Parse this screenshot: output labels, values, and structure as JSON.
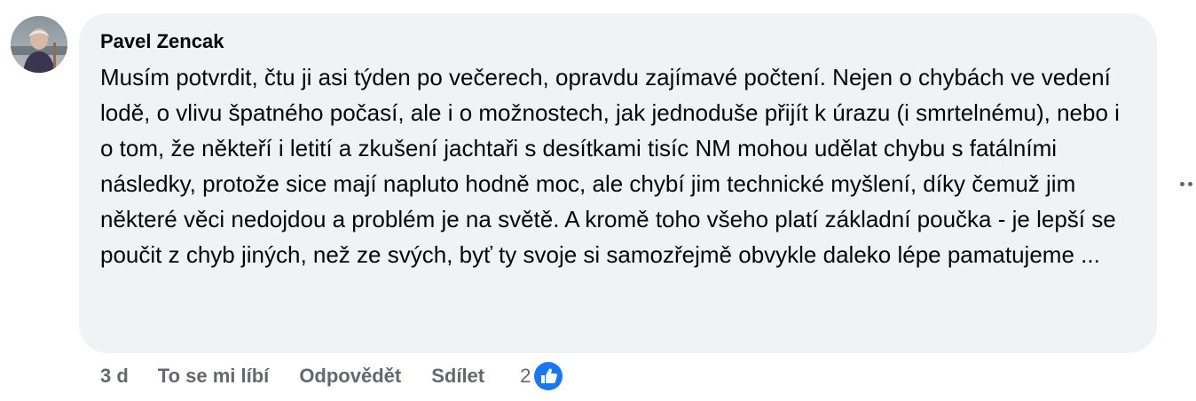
{
  "comment": {
    "author": "Pavel Zencak",
    "text": "Musím potvrdit, čtu ji asi týden po večerech, opravdu zajímavé počtení. Nejen o chybách ve vedení lodě, o vlivu špatného počasí, ale i o možnostech, jak jednoduše přijít k úrazu (i smrtelnému), nebo i o tom, že někteří i letití a zkušení jachtaři s desítkami tisíc NM mohou udělat chybu s fatálními následky, protože sice mají napluto hodně moc, ale chybí jim technické myšlení, díky čemuž jim některé věci nedojdou a problém je na světě. A kromě toho všeho platí základní poučka - je lepší se poučit z chyb jiných, než ze svých, byť ty svoje si samozřejmě obvykle daleko lépe pamatujeme ..."
  },
  "actions": {
    "time": "3 d",
    "like": "To se mi líbí",
    "reply": "Odpovědět",
    "share": "Sdílet"
  },
  "reactions": {
    "count": "2",
    "icon": "thumbs-up-icon",
    "color": "#1877f2"
  },
  "colors": {
    "bubble": "#f0f2f5",
    "secondary_text": "#65676b"
  }
}
